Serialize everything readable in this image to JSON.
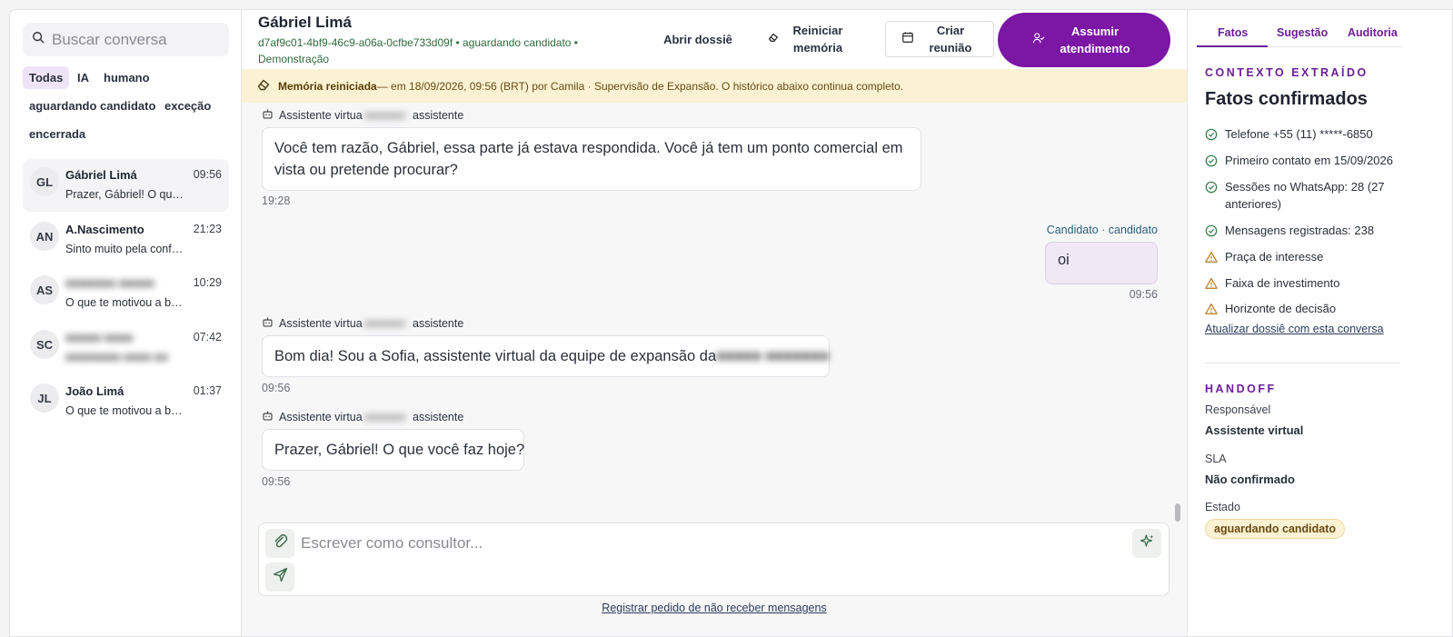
{
  "sidebar": {
    "search_placeholder": "Buscar conversa",
    "filters": [
      "Todas",
      "IA",
      "humano",
      "aguardando candidato",
      "exceção",
      "encerrada"
    ],
    "conversations": [
      {
        "initials": "GL",
        "name": "Gábriel Limá",
        "time": "09:56",
        "preview": "Prazer, Gábriel! O que você faz hoje?"
      },
      {
        "initials": "AN",
        "name": "A.Nascimento",
        "time": "21:23",
        "preview": "Sinto muito pela confusão"
      },
      {
        "initials": "AS",
        "name": "",
        "time": "10:29",
        "preview": "O que te motivou a buscar uma franquia?"
      },
      {
        "initials": "SC",
        "name": "",
        "time": "07:42",
        "preview": ""
      },
      {
        "initials": "JL",
        "name": "João Limá",
        "time": "01:37",
        "preview": "O que te motivou a buscar uma franquia?"
      }
    ]
  },
  "header": {
    "name": "Gábriel Limá",
    "meta": "d7af9c01-4bf9-46c9-a06a-0cfbe733d09f • aguardando candidato • Demonstração",
    "btn_dossie": "Abrir dossiê",
    "btn_memoria": "Reiniciar memória",
    "btn_reuniao": "Criar reunião",
    "btn_assumir": "Assumir atendimento"
  },
  "banner": {
    "title": "Memória reiniciada",
    "text": " — em 18/09/2026, 09:56 (BRT) por Camila · Supervisão de Expansão. O histórico abaixo continua completo."
  },
  "messages": {
    "sender_prefix": "Assistente virtua",
    "sender_suffix": "assistente",
    "m1_text": "Você tem razão, Gábriel, essa parte já estava respondida. Você já tem um ponto comercial em vista ou pretende procurar?",
    "m1_time": "19:28",
    "out_sender": "Candidato · candidato",
    "out_text": "oi",
    "out_time": "09:56",
    "m2_text": "Bom dia! Sou a Sofia, assistente virtual da equipe de expansão da",
    "m2_time": "09:56",
    "m3_text": "Prazer, Gábriel! O que você faz hoje?",
    "m3_time": "09:56"
  },
  "composer": {
    "placeholder": "Escrever como consultor...",
    "optout": "Registrar pedido de não receber mensagens"
  },
  "right": {
    "tabs": [
      "Fatos",
      "Sugestão",
      "Auditoria"
    ],
    "context_label": "CONTEXTO EXTRAÍDO",
    "title": "Fatos confirmados",
    "facts": [
      {
        "text": "Telefone +55 (11) *****-6850",
        "status": "ok"
      },
      {
        "text": "Primeiro contato em 15/09/2026",
        "status": "ok"
      },
      {
        "text": "Sessões no WhatsApp: 28 (27 anteriores)",
        "status": "ok"
      },
      {
        "text": "Mensagens registradas: 238",
        "status": "ok"
      },
      {
        "text": "Praça de interesse",
        "status": "warn"
      },
      {
        "text": "Faixa de investimento",
        "status": "warn"
      },
      {
        "text": "Horizonte de decisão",
        "status": "warn"
      }
    ],
    "update_link": "Atualizar dossiê com esta conversa",
    "handoff_label": "HANDOFF",
    "responsavel_label": "Responsável",
    "responsavel_value": "Assistente virtual",
    "sla_label": "SLA",
    "sla_value": "Não confirmado",
    "estado_label": "Estado",
    "estado_value": "aguardando candidato"
  },
  "colors": {
    "accent": "#7b16a5",
    "ok": "#2f7d4a",
    "warn": "#b7791f",
    "banner_bg": "#fbf2d4"
  }
}
